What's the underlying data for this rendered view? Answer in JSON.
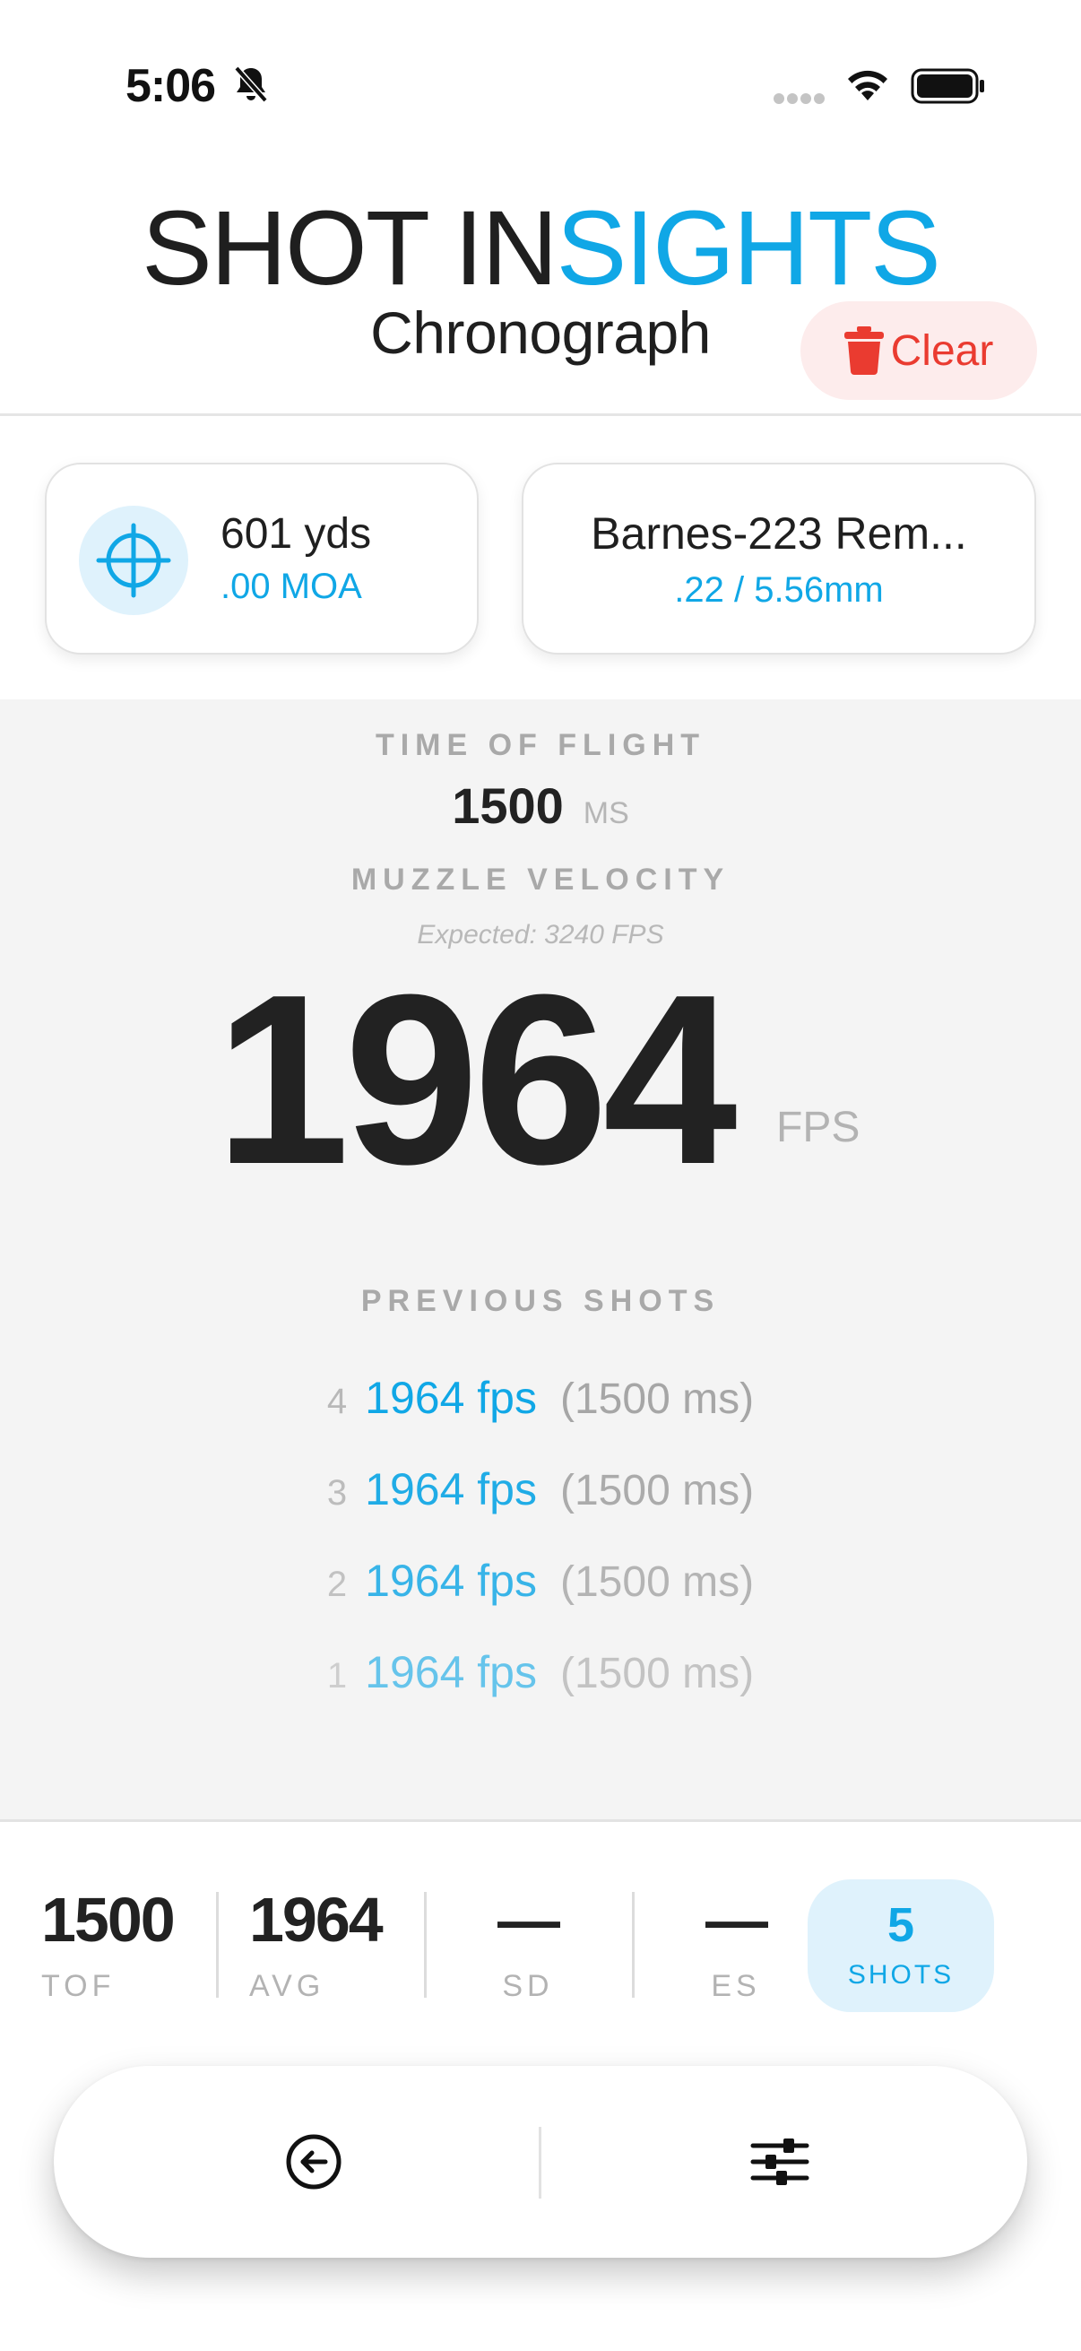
{
  "status_bar": {
    "time": "5:06",
    "icons": [
      "bell-slash-icon",
      "signal-dots-icon",
      "wifi-icon",
      "battery-icon"
    ]
  },
  "header": {
    "brand_part1": "SHOT IN",
    "brand_part2": "SIGHTS",
    "subtitle": "Chronograph",
    "clear_label": "Clear"
  },
  "range_card": {
    "distance": "601 yds",
    "moa": ".00 MOA",
    "icon": "crosshair-icon"
  },
  "ammo_card": {
    "name": "Barnes-223 Rem...",
    "caliber": ".22 / 5.56mm"
  },
  "readout": {
    "tof_label": "TIME OF FLIGHT",
    "tof_value": "1500",
    "tof_unit": "MS",
    "mv_label": "MUZZLE VELOCITY",
    "expected": "Expected: 3240 FPS",
    "velocity": "1964",
    "velocity_unit": "FPS"
  },
  "previous_shots": {
    "label": "PREVIOUS SHOTS",
    "items": [
      {
        "index": "4",
        "fps": "1964 fps",
        "ms": "(1500 ms)"
      },
      {
        "index": "3",
        "fps": "1964 fps",
        "ms": "(1500 ms)"
      },
      {
        "index": "2",
        "fps": "1964 fps",
        "ms": "(1500 ms)"
      },
      {
        "index": "1",
        "fps": "1964 fps",
        "ms": "(1500 ms)"
      }
    ]
  },
  "stats": {
    "tof": {
      "value": "1500",
      "label": "TOF"
    },
    "avg": {
      "value": "1964",
      "label": "AVG"
    },
    "sd": {
      "value": "—",
      "label": "SD"
    },
    "es": {
      "value": "—",
      "label": "ES"
    },
    "shots": {
      "count": "5",
      "label": "SHOTS"
    }
  },
  "nav": {
    "back_icon": "arrow-left-circle-icon",
    "settings_icon": "sliders-icon"
  },
  "colors": {
    "accent": "#10a7e6",
    "danger": "#ea3b30",
    "panel_bg": "#f4f4f4"
  }
}
